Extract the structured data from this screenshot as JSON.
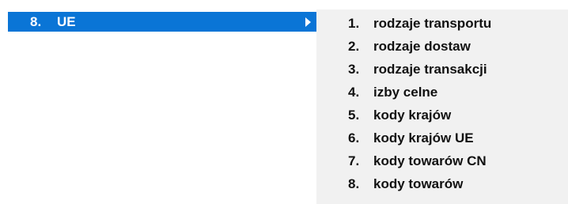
{
  "parent_menu": {
    "number": "8.",
    "label": "UE",
    "highlight_color": "#0a75d6",
    "arrow_icon": "submenu-arrow-right-icon"
  },
  "submenu": {
    "items": [
      {
        "number": "1.",
        "label": "rodzaje transportu"
      },
      {
        "number": "2.",
        "label": "rodzaje dostaw"
      },
      {
        "number": "3.",
        "label": "rodzaje transakcji"
      },
      {
        "number": "4.",
        "label": "izby celne"
      },
      {
        "number": "5.",
        "label": "kody krajów"
      },
      {
        "number": "6.",
        "label": "kody krajów UE"
      },
      {
        "number": "7.",
        "label": "kody towarów CN"
      },
      {
        "number": "8.",
        "label": "kody towarów"
      }
    ]
  }
}
